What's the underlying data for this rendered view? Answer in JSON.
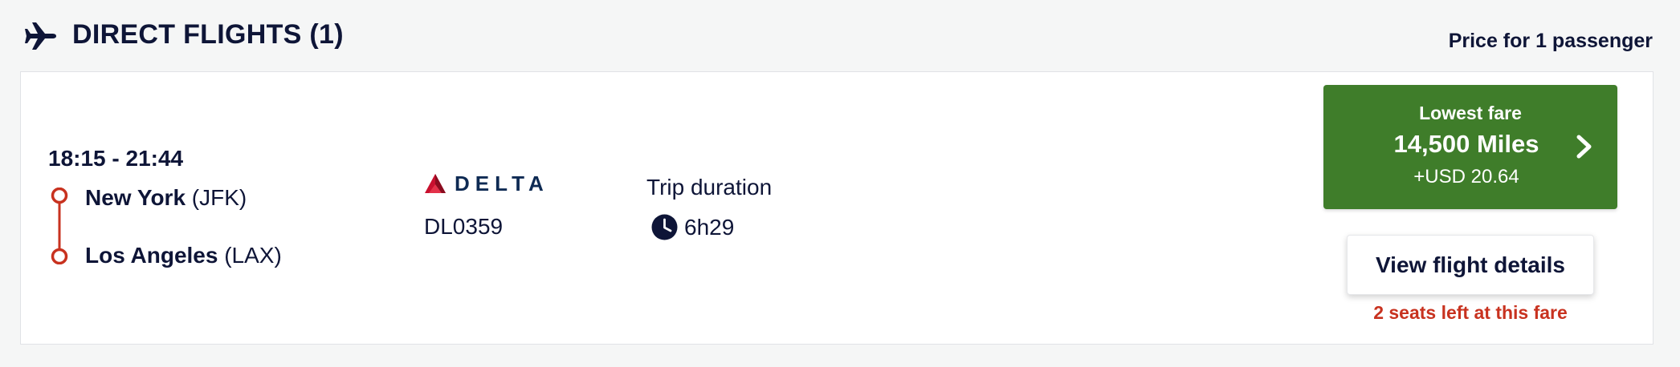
{
  "section": {
    "title": "DIRECT FLIGHTS (1)",
    "price_note": "Price for 1 passenger",
    "icon": "airplane-icon"
  },
  "flight": {
    "times": "18:15 - 21:44",
    "origin": {
      "city": "New York",
      "code": "(JFK)"
    },
    "destination": {
      "city": "Los Angeles",
      "code": "(LAX)"
    },
    "airline": {
      "name": "DELTA",
      "logo_color": "#c8102e",
      "icon": "delta-logo"
    },
    "flight_number": "DL0359",
    "duration_label": "Trip duration",
    "duration": "6h29",
    "duration_icon": "clock-icon"
  },
  "fare": {
    "label": "Lowest fare",
    "miles": "14,500 Miles",
    "tax": "+USD 20.64",
    "color": "#3f7d2a",
    "icon": "chevron-right-icon"
  },
  "details_button": "View flight details",
  "availability": {
    "text": "2 seats left at this fare",
    "color": "#c8321f"
  }
}
